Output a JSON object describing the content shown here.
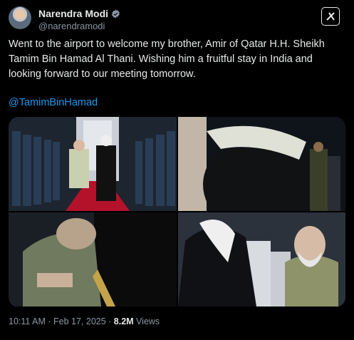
{
  "author": {
    "name": "Narendra Modi",
    "handle": "@narendramodi",
    "verified_icon": "verified-badge-icon"
  },
  "tweet": {
    "text": "Went to the airport to welcome my brother, Amir of Qatar H.H. Sheikh Tamim Bin Hamad Al Thani. Wishing him a fruitful stay in India and looking forward to our meeting tomorrow.",
    "mention": "@TamimBinHamad"
  },
  "meta": {
    "time": "10:11 AM",
    "sep1": " · ",
    "date": "Feb 17, 2025",
    "sep2": " · ",
    "views_count": "8.2M",
    "views_label": " Views"
  },
  "colors": {
    "background": "#000000",
    "text": "#e7e9ea",
    "muted": "#8b98a5",
    "link": "#1d9bf0"
  },
  "icons": {
    "grok": "grok-x-icon"
  }
}
